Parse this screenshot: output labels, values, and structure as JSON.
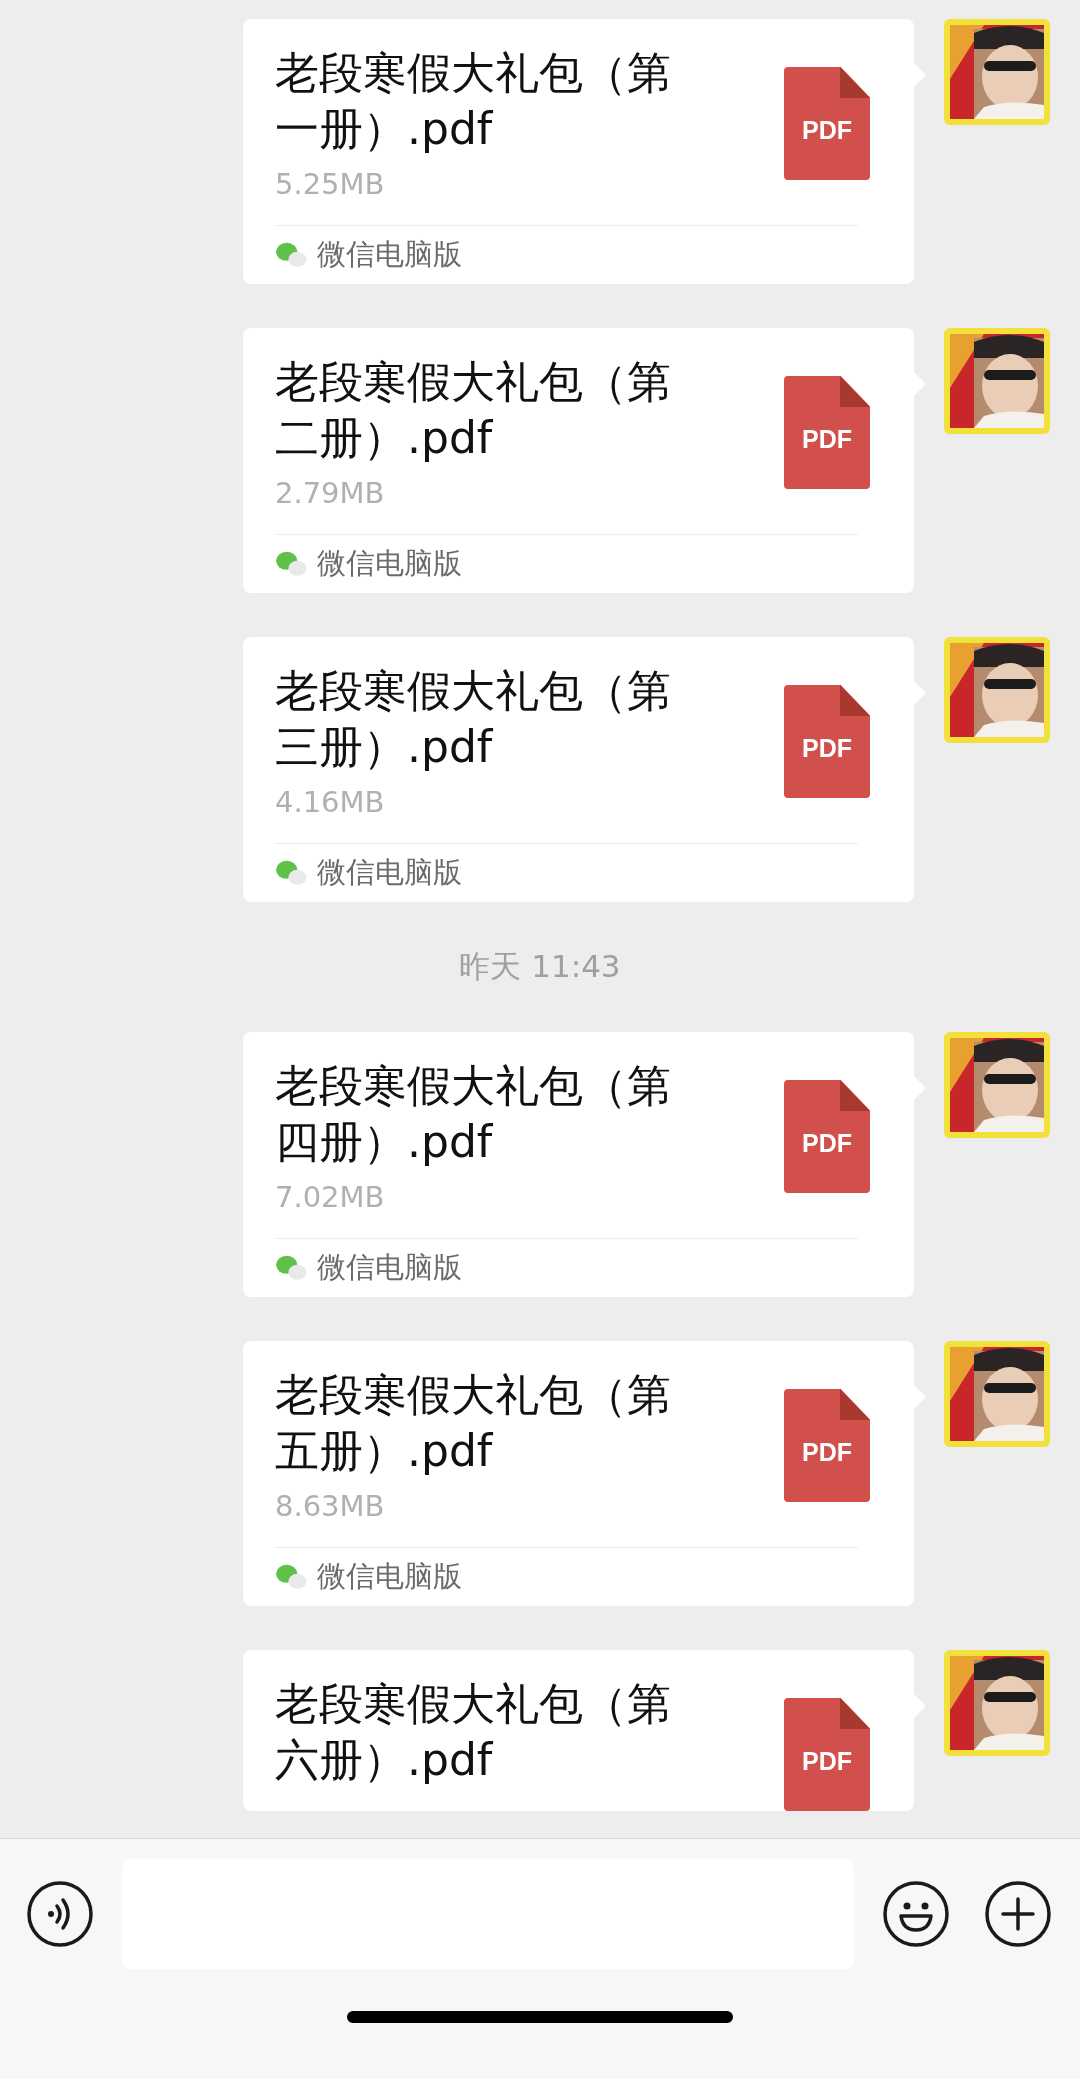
{
  "messages": [
    {
      "kind": "file",
      "title": "老段寒假大礼包（第一册）.pdf",
      "size": "5.25MB",
      "file_type": "PDF",
      "source": "微信电脑版"
    },
    {
      "kind": "file",
      "title": "老段寒假大礼包（第二册）.pdf",
      "size": "2.79MB",
      "file_type": "PDF",
      "source": "微信电脑版"
    },
    {
      "kind": "file",
      "title": "老段寒假大礼包（第三册）.pdf",
      "size": "4.16MB",
      "file_type": "PDF",
      "source": "微信电脑版"
    },
    {
      "kind": "time",
      "text": "昨天 11:43"
    },
    {
      "kind": "file",
      "title": "老段寒假大礼包（第四册）.pdf",
      "size": "7.02MB",
      "file_type": "PDF",
      "source": "微信电脑版"
    },
    {
      "kind": "file",
      "title": "老段寒假大礼包（第五册）.pdf",
      "size": "8.63MB",
      "file_type": "PDF",
      "source": "微信电脑版"
    },
    {
      "kind": "file",
      "title": "老段寒假大礼包（第六册）.pdf",
      "file_type": "PDF"
    }
  ]
}
